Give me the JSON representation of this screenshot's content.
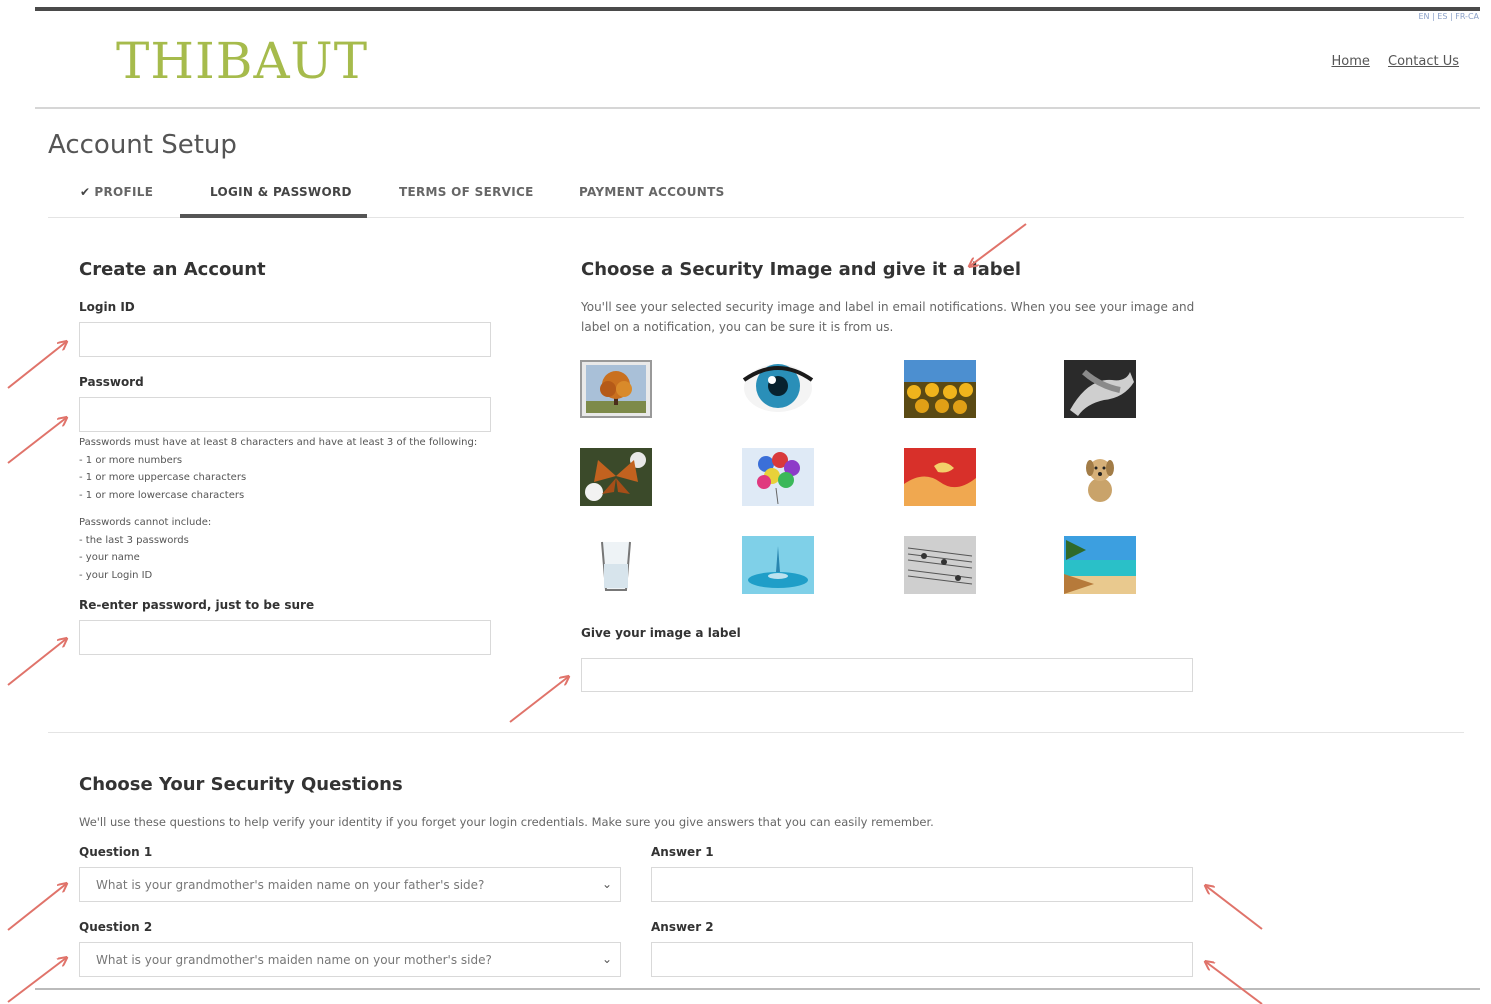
{
  "header": {
    "lang_links": "EN | ES | FR-CA",
    "logo": "THIBAUT",
    "nav": {
      "home": "Home",
      "contact": "Contact Us"
    }
  },
  "page_title": "Account Setup",
  "tabs": [
    {
      "label": "PROFILE",
      "completed": true
    },
    {
      "label": "LOGIN & PASSWORD",
      "active": true
    },
    {
      "label": "TERMS OF SERVICE"
    },
    {
      "label": "PAYMENT ACCOUNTS"
    }
  ],
  "create_account": {
    "title": "Create an Account",
    "login_label": "Login ID",
    "login_value": "",
    "password_label": "Password",
    "password_value": "",
    "password_rules": [
      "Passwords must have at least 8 characters and have at least 3 of the following:",
      "- 1 or more numbers",
      "- 1 or more uppercase characters",
      "- 1 or more lowercase characters"
    ],
    "password_excludes": [
      "Passwords cannot include:",
      "- the last 3 passwords",
      "- your name",
      "- your Login ID"
    ],
    "reenter_label": "Re-enter password, just to be sure",
    "reenter_value": ""
  },
  "security_image": {
    "title": "Choose a Security Image and give it a label",
    "description_line1": "You'll see your selected security image and label in email notifications. When you see your image and",
    "description_line2": "label on a notification, you can be sure it is from us.",
    "images": [
      "autumn-tree",
      "eye",
      "sunflowers",
      "hands",
      "butterfly",
      "balloons",
      "abstract-red",
      "dog",
      "glass",
      "water-drop",
      "sheet-music",
      "beach"
    ],
    "selected_index": 0,
    "label_caption": "Give your image a label",
    "label_value": ""
  },
  "security_questions": {
    "title": "Choose Your Security Questions",
    "description": "We'll use these questions to help verify your identity if you forget your login credentials. Make sure you give answers that you can easily remember.",
    "question1_label": "Question 1",
    "question1_value": "What is your grandmother's maiden name on your father's side?",
    "answer1_label": "Answer 1",
    "answer1_value": "",
    "question2_label": "Question 2",
    "question2_value": "What is your grandmother's maiden name on your mother's side?",
    "answer2_label": "Answer 2",
    "answer2_value": ""
  },
  "colors": {
    "logo": "#a6bb4c",
    "annotation_arrow": "#e0736a"
  }
}
